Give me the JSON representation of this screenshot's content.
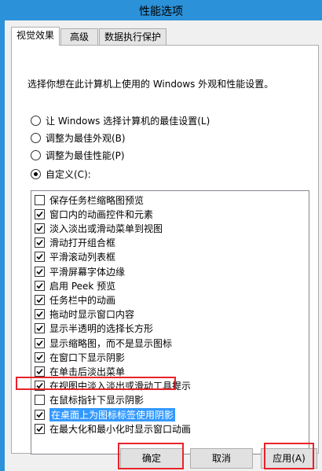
{
  "window": {
    "title": "性能选项"
  },
  "tabs": [
    {
      "label": "视觉效果",
      "active": true
    },
    {
      "label": "高级",
      "active": false
    },
    {
      "label": "数据执行保护",
      "active": false
    }
  ],
  "description": "选择你想在此计算机上使用的 Windows 外观和性能设置。",
  "radio_options": [
    {
      "label": "让 Windows 选择计算机的最佳设置(L)",
      "selected": false
    },
    {
      "label": "调整为最佳外观(B)",
      "selected": false
    },
    {
      "label": "调整为最佳性能(P)",
      "selected": false
    },
    {
      "label": "自定义(C):",
      "selected": true
    }
  ],
  "effects": [
    {
      "label": "保存任务栏缩略图预览",
      "checked": false
    },
    {
      "label": "窗口内的动画控件和元素",
      "checked": true
    },
    {
      "label": "淡入淡出或滑动菜单到视图",
      "checked": true
    },
    {
      "label": "滑动打开组合框",
      "checked": true
    },
    {
      "label": "平滑滚动列表框",
      "checked": true
    },
    {
      "label": "平滑屏幕字体边缘",
      "checked": true
    },
    {
      "label": "启用 Peek 预览",
      "checked": true
    },
    {
      "label": "任务栏中的动画",
      "checked": true
    },
    {
      "label": "拖动时显示窗口内容",
      "checked": true
    },
    {
      "label": "显示半透明的选择长方形",
      "checked": true
    },
    {
      "label": "显示缩略图，而不是显示图标",
      "checked": true
    },
    {
      "label": "在窗口下显示阴影",
      "checked": true
    },
    {
      "label": "在单击后淡出菜单",
      "checked": true
    },
    {
      "label": "在视图中淡入淡出或滑动工具提示",
      "checked": true
    },
    {
      "label": "在鼠标指针下显示阴影",
      "checked": false
    },
    {
      "label": "在桌面上为图标标签使用阴影",
      "checked": true,
      "selected": true
    },
    {
      "label": "在最大化和最小化时显示窗口动画",
      "checked": true
    }
  ],
  "buttons": {
    "ok": "确定",
    "cancel": "取消",
    "apply": "应用(A)"
  },
  "colors": {
    "title_bar": "#2b91d8",
    "selection": "#3399ff",
    "annotation": "#e8232a"
  }
}
